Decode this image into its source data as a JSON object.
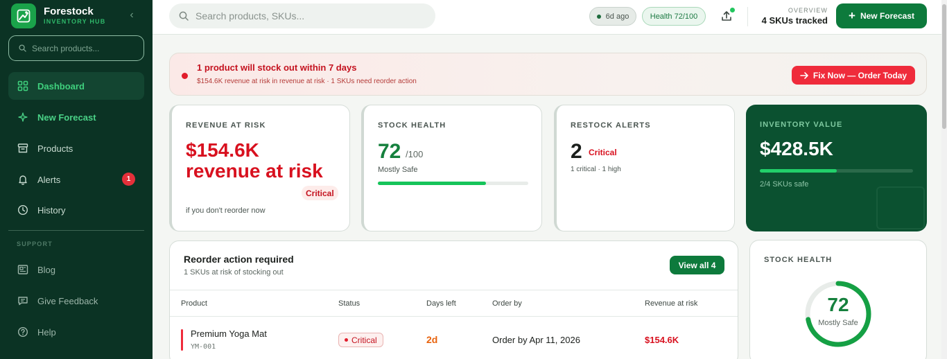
{
  "brand": {
    "name": "Forestock",
    "subtitle": "INVENTORY HUB"
  },
  "sidebar": {
    "search_placeholder": "Search products...",
    "items": [
      {
        "label": "Dashboard"
      },
      {
        "label": "New Forecast"
      },
      {
        "label": "Products"
      },
      {
        "label": "Alerts",
        "badge": "1"
      },
      {
        "label": "History"
      }
    ],
    "support_heading": "SUPPORT",
    "support_items": [
      {
        "label": "Blog"
      },
      {
        "label": "Give Feedback"
      },
      {
        "label": "Help"
      }
    ]
  },
  "topbar": {
    "search_placeholder": "Search products, SKUs...",
    "last_updated": "6d ago",
    "health": "Health 72/100",
    "overview_label": "OVERVIEW",
    "overview_value": "4 SKUs tracked",
    "new_forecast": "New Forecast"
  },
  "alert": {
    "title": "1 product will stock out within 7 days",
    "subtitle": "$154.6K revenue at risk in revenue at risk · 1 SKUs need reorder action",
    "action": "Fix Now — Order Today"
  },
  "cards": {
    "revenue": {
      "label": "REVENUE AT RISK",
      "value": "$154.6K revenue at risk",
      "tag": "Critical",
      "sub": "if you don't reorder now"
    },
    "health": {
      "label": "STOCK HEALTH",
      "value": "72",
      "denominator": "/100",
      "sub": "Mostly Safe",
      "progress": 0.72
    },
    "restock": {
      "label": "RESTOCK ALERTS",
      "value": "2",
      "tag": "Critical",
      "sub": "1 critical · 1 high"
    },
    "inventory": {
      "label": "INVENTORY VALUE",
      "value": "$428.5K",
      "sub": "2/4 SKUs safe",
      "progress": 0.5
    }
  },
  "reorder": {
    "title": "Reorder action required",
    "subtitle": "1 SKUs at risk of stocking out",
    "view_all": "View all 4",
    "columns": [
      "Product",
      "Status",
      "Days left",
      "Order by",
      "Revenue at risk"
    ],
    "rows": [
      {
        "product": "Premium Yoga Mat",
        "sku": "YM-001",
        "status": "Critical",
        "days_left": "2d",
        "order_by": "Order by Apr 11, 2026",
        "revenue": "$154.6K"
      }
    ]
  },
  "stock_health_ring": {
    "label": "STOCK HEALTH",
    "value": "72",
    "sub": "Mostly Safe",
    "progress": 0.72
  },
  "colors": {
    "brand_green": "#0d7a3c",
    "critical_red": "#d8111f",
    "sidebar_bg": "#0b3324",
    "accent_green": "#22c55e"
  }
}
